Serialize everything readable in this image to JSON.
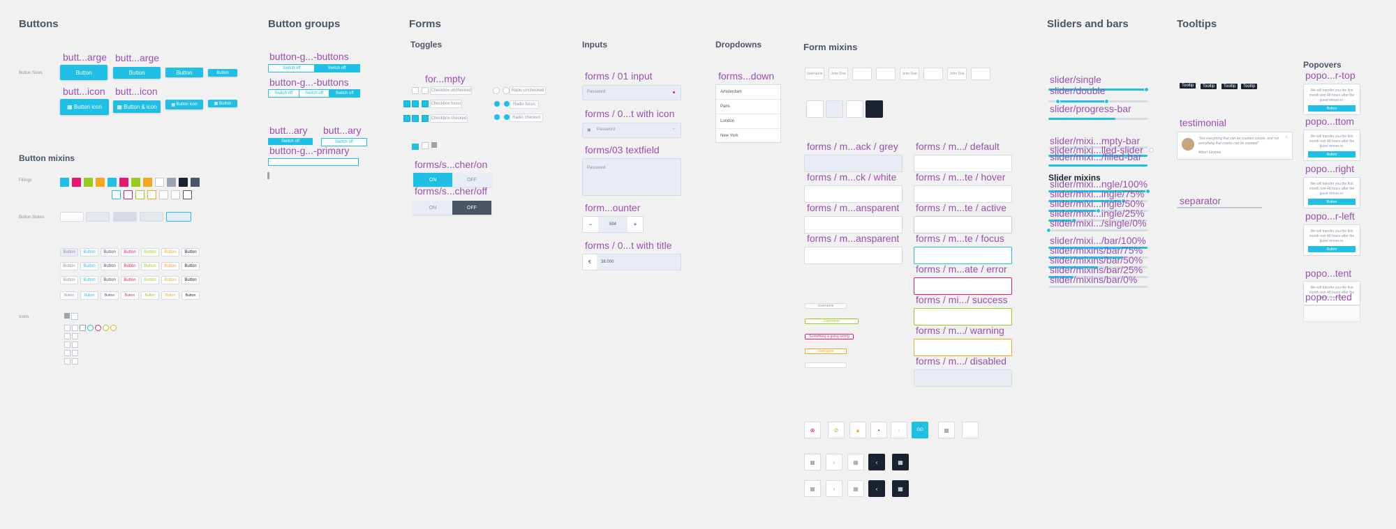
{
  "sections": {
    "buttons": "Buttons",
    "button_mixins": "Button mixins",
    "button_groups": "Button groups",
    "forms": "Forms",
    "toggles": "Toggles",
    "inputs": "Inputs",
    "dropdowns": "Dropdowns",
    "form_mixins": "Form mixins",
    "sliders_bars": "Sliders and bars",
    "tooltips": "Tooltips",
    "popovers": "Popovers",
    "slider_mixins": "Slider mixins"
  },
  "buttons": {
    "sizes_label": "Button Sizes",
    "large_title_1": "butt...arge",
    "large_title_2": "butt...arge",
    "icon_title_1": "butt...icon",
    "icon_title_2": "butt...icon",
    "button": "Button",
    "button_icon": "Button icon",
    "button_and_icon": "Button & icon"
  },
  "mixins": {
    "fillings_label": "Fillings",
    "states_label": "Button States",
    "icons_label": "Icons",
    "button": "Button",
    "fill_colors": [
      "#1fbfe6",
      "#e6196c",
      "#9ccb20",
      "#f5a623",
      "#1fbfe6",
      "#e6196c",
      "#9ccb20",
      "#f5a623",
      "#ffffff",
      "#9aa4b1",
      "#1b2333",
      "#4a5568"
    ],
    "outline_colors": [
      "#1fbfe6",
      "#e6196c",
      "#9ccb20",
      "#f5a623",
      "#c3cad4",
      "#c3cad4",
      "#4a5568"
    ],
    "text_colors": [
      "#8a94a3",
      "#1fbfe6",
      "#4a5568",
      "#e6196c",
      "#9ccb20",
      "#f5a623",
      "#1b2333"
    ]
  },
  "groups": {
    "title_1": "button-g...-buttons",
    "title_2": "button-g...-buttons",
    "title_3": "butt...ary",
    "title_4": "butt...ary",
    "title_5": "button-g...-primary",
    "switch_off": "Switch off"
  },
  "toggles": {
    "title_empty": "for...mpty",
    "checkbox_unchecked": "Checkbox unchecked",
    "checkbox_focus": "Checkbox focus",
    "checkbox_checked": "Checkbox checked",
    "radio_unchecked": "Radio unchecked",
    "radio_focus": "Radio focus",
    "radio_checked": "Radio checked",
    "switcher_on_title": "forms/s...cher/on",
    "switcher_off_title": "forms/s...cher/off",
    "on": "ON",
    "off": "OFF"
  },
  "inputs": {
    "title_1": "forms / 01 input",
    "title_2": "forms / 0...t with icon",
    "title_3": "forms/03 textfield",
    "title_4": "form...ounter",
    "title_5": "forms / 0...t with title",
    "password": "Password",
    "counter_value": "594",
    "minus": "−",
    "plus": "+",
    "currency": "€",
    "amount": "38.000"
  },
  "dropdowns": {
    "title": "forms...down",
    "options": [
      "Amsterdam",
      "Paris",
      "London",
      "New York"
    ]
  },
  "form_mixins": {
    "username": "Username",
    "john": "John Doe",
    "left": [
      "forms / m...ack / grey",
      "forms / m...ck / white",
      "forms / m...ansparent",
      "forms / m...ansparent"
    ],
    "right": [
      "forms / m.../ default",
      "forms / m...te / hover",
      "forms / m...te / active",
      "forms / m...te / focus",
      "forms / m...ate / error",
      "forms / mi.../ success",
      "forms / m.../ warning",
      "forms / m.../ disabled"
    ],
    "go": "GO",
    "error_text": "Something is going wrong"
  },
  "sliders": {
    "single": "slider/single",
    "double": "slider/double",
    "progress": "slider/progress-bar",
    "m_empty": "slider/mixi...mpty-bar",
    "m_filled_slider": "slider/mixi...lled-slider",
    "m_filled_bar": "slider/mixi.../filled-bar",
    "s_100": "slider/mixi...ngle/100%",
    "s_75": "slider/mixi...ingle/75%",
    "s_50": "slider/mixi...ingle/50%",
    "s_25": "slider/mixi...ingle/25%",
    "s_0": "slider/mixi.../single/0%",
    "b_100": "slider/mixi.../bar/100%",
    "b_75": "slider/mixins/bar/75%",
    "b_50": "slider/mixins/bar/50%",
    "b_25": "slider/mixins/bar/25%",
    "b_0": "slider/mixins/bar/0%",
    "single_levels": [
      1.0,
      0.75,
      0.5,
      0.25,
      0.0
    ],
    "bar_levels": [
      1.0,
      0.75,
      0.5,
      0.25,
      0.0
    ]
  },
  "tooltips": {
    "tooltip": "Tooltip",
    "testimonial": "testimonial",
    "quote": "\"Not everything that can be counted counts, and not everything that counts can be counted\"",
    "author": "Albert Einstein",
    "separator": "separator"
  },
  "popovers": {
    "top": "popo...r-top",
    "bottom": "popo...ttom",
    "right": "popo...right",
    "left": "popo...r-left",
    "content": "popo...tent",
    "rted": "popo...rted",
    "text": "We will transfer you the first month rent 48 hours after the guest moves in.",
    "button": "Button"
  }
}
